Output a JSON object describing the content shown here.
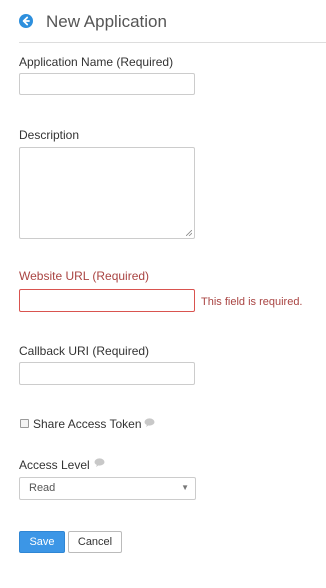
{
  "header": {
    "title": "New Application",
    "back_icon": "back-arrow-circle-icon"
  },
  "form": {
    "app_name": {
      "label": "Application Name (Required)",
      "value": ""
    },
    "description": {
      "label": "Description",
      "value": ""
    },
    "website_url": {
      "label": "Website URL (Required)",
      "value": "",
      "error": "This field is required."
    },
    "callback_uri": {
      "label": "Callback URI (Required)",
      "value": ""
    },
    "share_token": {
      "label": "Share Access Token",
      "checked": false,
      "info_icon": "speech-bubble-icon"
    },
    "access_level": {
      "label": "Access Level",
      "selected": "Read",
      "info_icon": "speech-bubble-icon"
    }
  },
  "buttons": {
    "save": "Save",
    "cancel": "Cancel"
  },
  "colors": {
    "accent": "#3c96e6",
    "error": "#a94442",
    "error_border": "#d9534f"
  }
}
